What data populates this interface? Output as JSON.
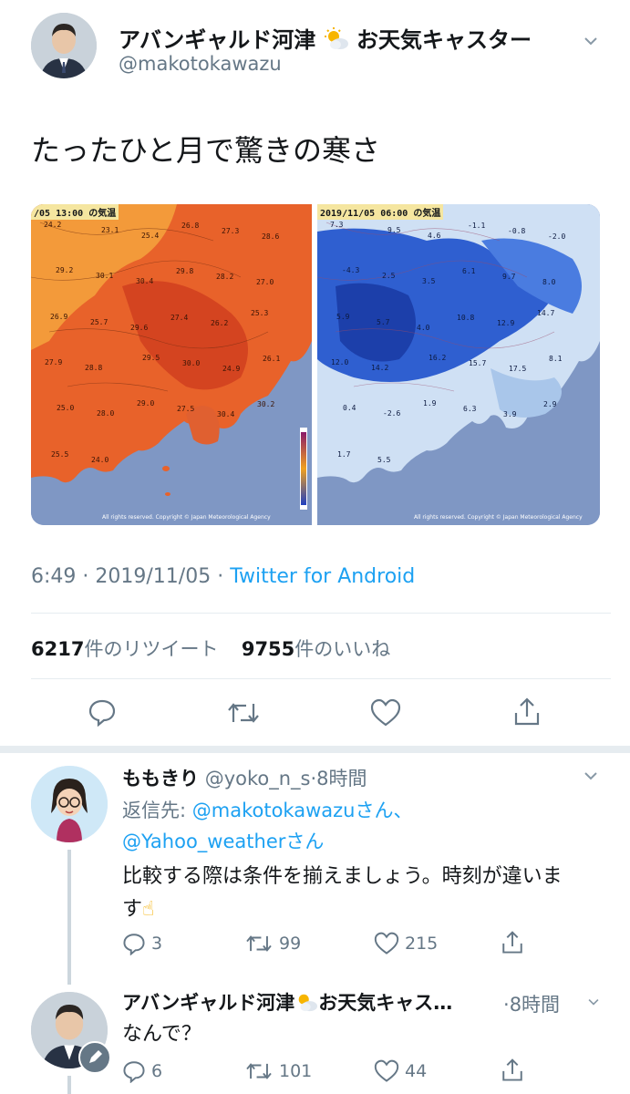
{
  "tweet": {
    "author_name": "アバンギャルド河津",
    "author_suffix": "お天気キャスター",
    "author_handle": "@makotokawazu",
    "text": "たったひと月で驚きの寒さ",
    "image_left": {
      "label": "/05 13:00 の気温",
      "copyright": "All rights reserved. Copyright © Japan Meteorological Agency",
      "values": [
        "24.2",
        "23.1",
        "25.4",
        "26.8",
        "27.3",
        "28.6",
        "29.2",
        "30.1",
        "30.4",
        "29.8",
        "28.2",
        "27.0",
        "26.9",
        "25.7",
        "29.6",
        "27.4",
        "26.2",
        "25.3",
        "27.9",
        "28.8",
        "29.5",
        "30.0",
        "24.9",
        "26.1",
        "25.0",
        "28.0",
        "29.0",
        "27.5",
        "30.4",
        "30.2",
        "25.5",
        "24.0"
      ]
    },
    "image_right": {
      "label": "2019/11/05 06:00 の気温",
      "copyright": "All rights reserved. Copyright © Japan Meteorological Agency",
      "values": [
        "7.3",
        "9.5",
        "4.6",
        "-1.1",
        "-0.8",
        "-2.0",
        "-4.3",
        "2.5",
        "3.5",
        "6.1",
        "9.7",
        "8.0",
        "5.9",
        "5.7",
        "4.0",
        "10.8",
        "12.9",
        "14.7",
        "12.0",
        "14.2",
        "16.2",
        "15.7",
        "17.5",
        "8.1",
        "0.4",
        "-2.6",
        "1.9",
        "6.3",
        "3.9",
        "2.9",
        "1.7",
        "5.5"
      ]
    },
    "time": "6:49",
    "sep": "·",
    "date": "2019/11/05",
    "client": "Twitter for Android",
    "retweets": "6217",
    "retweets_label": "件のリツイート",
    "likes": "9755",
    "likes_label": "件のいいね"
  },
  "reply1": {
    "name": "ももきり",
    "handle": "@yoko_n_s",
    "time": "8時間",
    "sep": "·",
    "reply_to_prefix": "返信先: ",
    "reply_to_1": "@makotokawazu",
    "reply_to_1_suffix": "さん、",
    "reply_to_2": "@Yahoo_weather",
    "reply_to_2_suffix": "さん",
    "text_line1": "比較する際は条件を揃えましょう。時刻が違いま",
    "text_line2": "す",
    "emoji": "☝",
    "reply_count": "3",
    "retweet_count": "99",
    "like_count": "215"
  },
  "reply2": {
    "name": "アバンギャルド河津",
    "suffix": "お天気キャス…",
    "time": "8時間",
    "sep": "·",
    "text": "なんで？",
    "reply_count": "6",
    "retweet_count": "101",
    "like_count": "44"
  },
  "colors": {
    "link": "#1da1f2",
    "muted": "#657786",
    "divider": "#e6ecf0",
    "warm": "#e8622a",
    "cool": "#2f5fd0"
  },
  "icons": [
    "chevron-down-icon",
    "sun-cloud-icon",
    "reply-icon",
    "retweet-icon",
    "like-icon",
    "share-icon",
    "pen-icon",
    "pointing-up-emoji-icon"
  ]
}
